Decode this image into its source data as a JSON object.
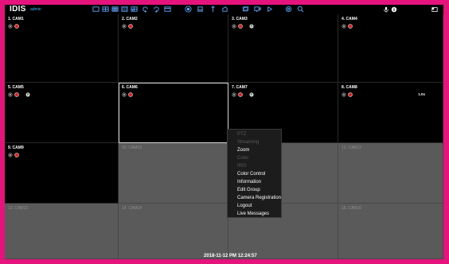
{
  "app": {
    "logo": "IDIS",
    "user": "admin"
  },
  "toolbar": {
    "left_icons": [
      "layout-1x1-icon",
      "layout-2x2-icon",
      "layout-3x3-icon",
      "layout-4x4-icon",
      "layout-custom-icon",
      "previous-group-icon",
      "next-group-icon",
      "fullscreen-icon",
      "record-icon",
      "alarm-out-icon",
      "audio-icon",
      "sequence-icon",
      "group-icon",
      "ptz-icon",
      "play-icon",
      "camera-setup-icon",
      "zoom-search-icon"
    ],
    "right_icons": [
      "mic-icon",
      "info-icon",
      "system-icon"
    ]
  },
  "cameras": [
    {
      "label": "1. CAM1",
      "type": "live",
      "statuses": [
        "record-status-icon",
        "alarm-status-icon"
      ]
    },
    {
      "label": "2. CAM2",
      "type": "live",
      "statuses": [
        "record-status-icon",
        "alarm-status-icon"
      ]
    },
    {
      "label": "3. CAM3",
      "type": "live",
      "statuses": [
        "record-status-icon",
        "alarm-status-icon"
      ],
      "ptz": true
    },
    {
      "label": "4. CAM4",
      "type": "live",
      "statuses": [
        "record-status-icon",
        "alarm-status-icon"
      ]
    },
    {
      "label": "5. CAM5",
      "type": "live",
      "statuses": [
        "record-status-icon",
        "alarm-status-icon"
      ],
      "ptz": true
    },
    {
      "label": "6. CAM6",
      "type": "live",
      "statuses": [
        "record-status-icon",
        "alarm-status-icon"
      ],
      "selected": true
    },
    {
      "label": "7. CAM7",
      "type": "live",
      "statuses": [
        "record-status-icon",
        "alarm-status-icon"
      ],
      "ptz": true
    },
    {
      "label": "8. CAM8",
      "type": "live",
      "statuses": [
        "record-status-icon",
        "alarm-status-icon"
      ],
      "speed": "1.0x"
    },
    {
      "label": "9. CAM9",
      "type": "live",
      "statuses": [
        "record-status-icon",
        "alarm-status-icon"
      ]
    },
    {
      "label": "10. CAM10",
      "type": "empty"
    },
    {
      "label": "",
      "type": "empty"
    },
    {
      "label": "12. CAM12",
      "type": "empty"
    },
    {
      "label": "13. CAM13",
      "type": "empty"
    },
    {
      "label": "14. CAM14",
      "type": "empty"
    },
    {
      "label": "",
      "type": "empty"
    },
    {
      "label": "16. CAM16",
      "type": "empty"
    }
  ],
  "context_menu": [
    {
      "label": "PTZ",
      "enabled": false
    },
    {
      "label": "Streaming",
      "enabled": false
    },
    {
      "label": "Zoom",
      "enabled": true
    },
    {
      "label": "Color",
      "enabled": false
    },
    {
      "label": "IRIS",
      "enabled": false
    },
    {
      "label": "Color Control",
      "enabled": true
    },
    {
      "label": "Information",
      "enabled": true
    },
    {
      "label": "Edit Group",
      "enabled": true
    },
    {
      "label": "Camera Registration",
      "enabled": true
    },
    {
      "label": "Logout",
      "enabled": true
    },
    {
      "label": "Live Messages",
      "enabled": true
    }
  ],
  "timestamp": "2018-11-12 PM 12:24:57",
  "colors": {
    "border": "#e4147c",
    "toolbar_icon": "#5ea7ff",
    "status_red": "#e02020",
    "empty_cell": "#5a5a5a"
  }
}
